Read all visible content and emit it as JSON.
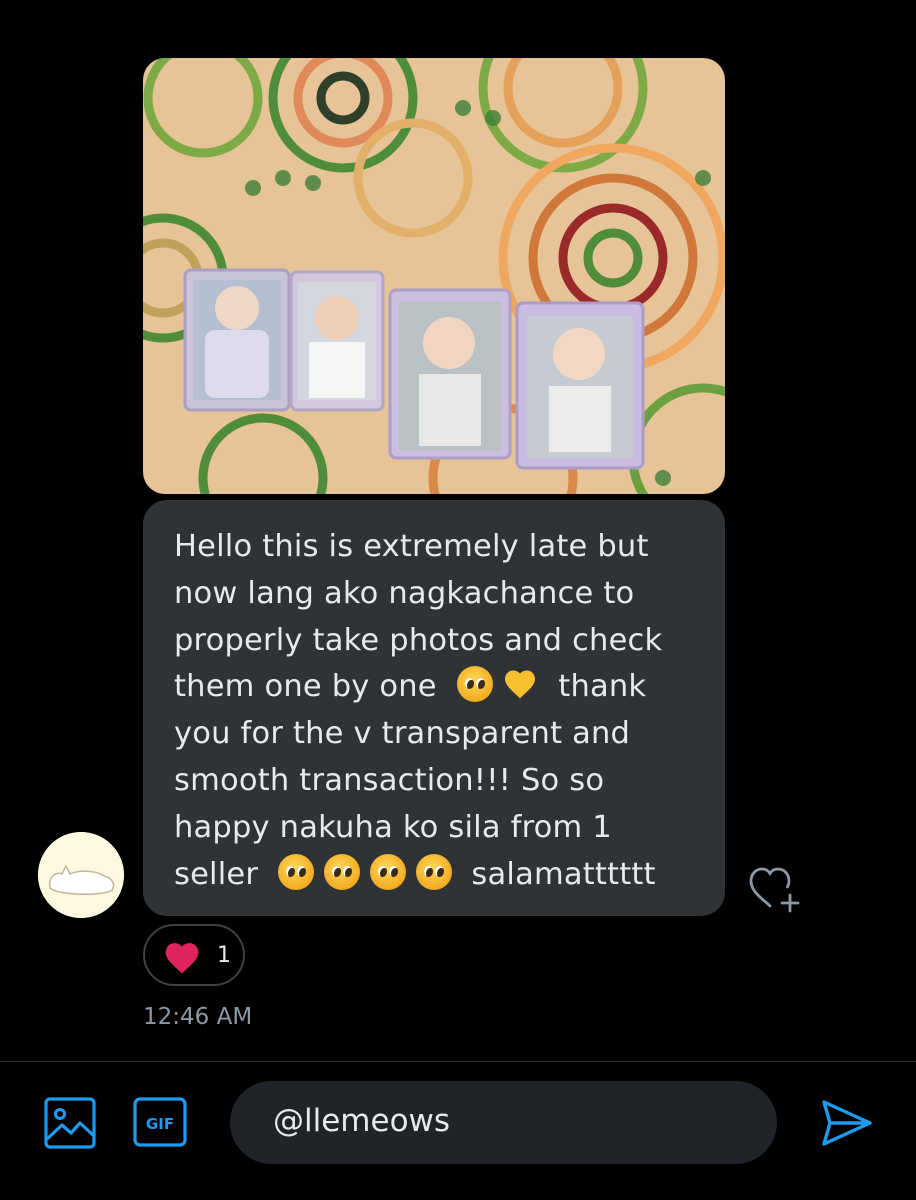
{
  "message": {
    "lines": [
      "Hello this is extremely late but",
      "now lang ako nagkachance to",
      "properly take photos and check",
      "them one by one",
      "thank",
      "you for the v transparent and",
      "smooth transaction!!! So so",
      "happy nakuha ko sila from 1",
      "seller",
      "salamatttttt"
    ],
    "emoji": [
      "pleading-face",
      "yellow-heart"
    ]
  },
  "reaction": {
    "emoji": "red-heart",
    "count": "1"
  },
  "timestamp": "12:46 AM",
  "composer": {
    "value": "@llemeows"
  },
  "icons": {
    "media": "image-icon",
    "gif": "GIF",
    "send": "send-icon",
    "add_reaction": "heart-plus-icon"
  },
  "colors": {
    "accent": "#1d9bf0",
    "bubble": "#2f3336",
    "background": "#000000",
    "heart": "#e0245e"
  }
}
